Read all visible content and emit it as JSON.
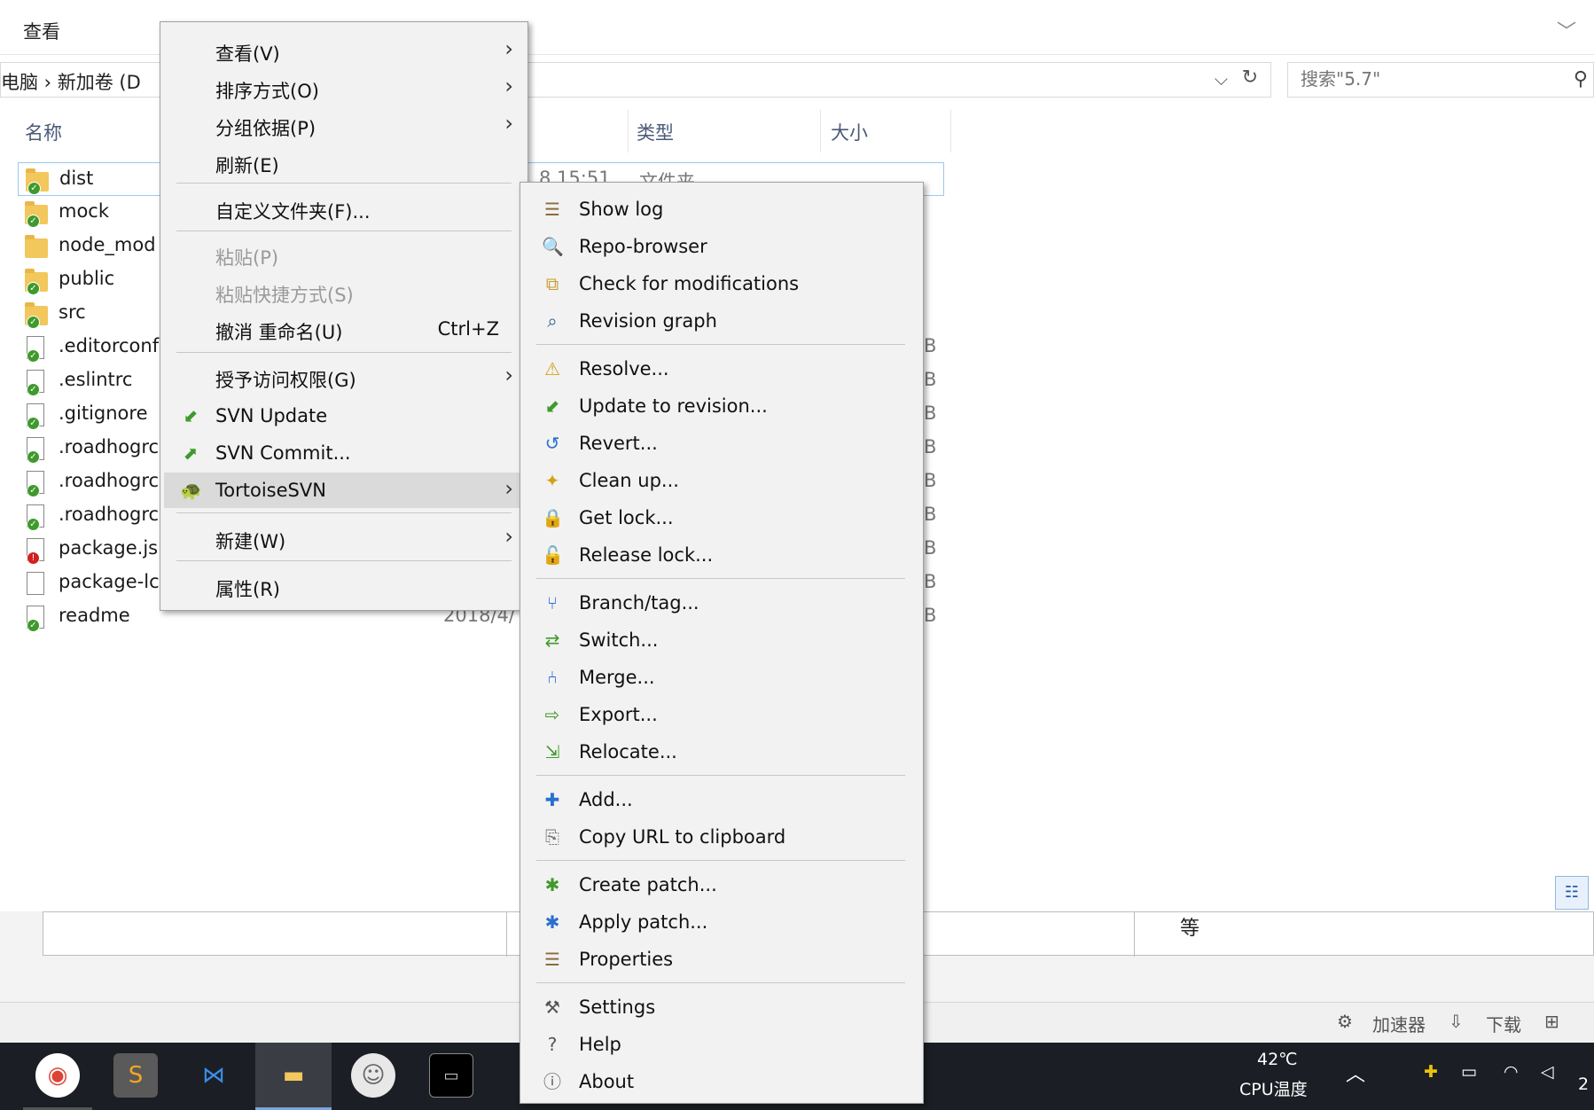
{
  "ribbon": {
    "tab_view": "查看",
    "expand_icon": "chevron-down-icon"
  },
  "address": {
    "path": "电脑  ›  新加卷 (D"
  },
  "search": {
    "placeholder": "搜索\"5.7\""
  },
  "columns": {
    "name": "名称",
    "type": "类型",
    "size": "大小"
  },
  "files": [
    {
      "name": "dist",
      "kind": "folder",
      "date": "8 15:51",
      "type": "文件夹",
      "size": ""
    },
    {
      "name": "mock",
      "kind": "folder",
      "date": "",
      "type": "",
      "size": ""
    },
    {
      "name": "node_mod",
      "kind": "folder-plain",
      "date": "",
      "type": "",
      "size": ""
    },
    {
      "name": "public",
      "kind": "folder",
      "date": "",
      "type": "",
      "size": ""
    },
    {
      "name": "src",
      "kind": "folder",
      "date": "",
      "type": "",
      "size": ""
    },
    {
      "name": ".editorconf",
      "kind": "doc",
      "date": "",
      "type": "",
      "size": "B"
    },
    {
      "name": ".eslintrc",
      "kind": "doc",
      "date": "",
      "type": "",
      "size": "B"
    },
    {
      "name": ".gitignore",
      "kind": "doc",
      "date": "",
      "type": "",
      "size": "B"
    },
    {
      "name": ".roadhogrc",
      "kind": "doc",
      "date": "",
      "type": "",
      "size": "B"
    },
    {
      "name": ".roadhogrc",
      "kind": "doc",
      "date": "",
      "type": "",
      "size": "B"
    },
    {
      "name": ".roadhogrc",
      "kind": "doc-modified",
      "date": "",
      "type": "",
      "size": "B"
    },
    {
      "name": "package.js",
      "kind": "doc-error",
      "date": "",
      "type": "",
      "size": "B"
    },
    {
      "name": "package-lc",
      "kind": "doc-plain",
      "date": "",
      "type": "",
      "size": "B"
    },
    {
      "name": "readme",
      "kind": "doc",
      "date": "2018/4/",
      "type": "",
      "size": "B"
    }
  ],
  "context_menu": {
    "items": [
      {
        "label": "查看(V)",
        "submenu": true
      },
      {
        "label": "排序方式(O)",
        "submenu": true
      },
      {
        "label": "分组依据(P)",
        "submenu": true
      },
      {
        "label": "刷新(E)"
      },
      {
        "label": "自定义文件夹(F)..."
      },
      {
        "label": "粘贴(P)",
        "disabled": true
      },
      {
        "label": "粘贴快捷方式(S)",
        "disabled": true
      },
      {
        "label": "撤消 重命名(U)",
        "shortcut": "Ctrl+Z"
      },
      {
        "label": "授予访问权限(G)",
        "submenu": true
      },
      {
        "label": "SVN Update",
        "icon": "svn-update-icon"
      },
      {
        "label": "SVN Commit...",
        "icon": "svn-commit-icon"
      },
      {
        "label": "TortoiseSVN",
        "icon": "tortoise-icon",
        "submenu": true
      },
      {
        "label": "新建(W)",
        "submenu": true
      },
      {
        "label": "属性(R)"
      }
    ]
  },
  "svn_menu": {
    "items": [
      {
        "label": "Show log",
        "icon": "show-log-icon"
      },
      {
        "label": "Repo-browser",
        "icon": "repo-browser-icon"
      },
      {
        "label": "Check for modifications",
        "icon": "check-modifications-icon"
      },
      {
        "label": "Revision graph",
        "icon": "revision-graph-icon"
      },
      {
        "label": "Resolve...",
        "icon": "resolve-icon"
      },
      {
        "label": "Update to revision...",
        "icon": "update-revision-icon"
      },
      {
        "label": "Revert...",
        "icon": "revert-icon"
      },
      {
        "label": "Clean up...",
        "icon": "cleanup-icon"
      },
      {
        "label": "Get lock...",
        "icon": "lock-icon"
      },
      {
        "label": "Release lock...",
        "icon": "unlock-icon"
      },
      {
        "label": "Branch/tag...",
        "icon": "branch-icon"
      },
      {
        "label": "Switch...",
        "icon": "switch-icon"
      },
      {
        "label": "Merge...",
        "icon": "merge-icon"
      },
      {
        "label": "Export...",
        "icon": "export-icon"
      },
      {
        "label": "Relocate...",
        "icon": "relocate-icon"
      },
      {
        "label": "Add...",
        "icon": "add-icon"
      },
      {
        "label": "Copy URL to clipboard",
        "icon": "copy-url-icon"
      },
      {
        "label": "Create patch...",
        "icon": "create-patch-icon"
      },
      {
        "label": "Apply patch...",
        "icon": "apply-patch-icon"
      },
      {
        "label": "Properties",
        "icon": "properties-icon"
      },
      {
        "label": "Settings",
        "icon": "settings-icon"
      },
      {
        "label": "Help",
        "icon": "help-icon"
      },
      {
        "label": "About",
        "icon": "about-icon"
      }
    ]
  },
  "background_doc": {
    "cell_text": "等"
  },
  "statusbar": {
    "accelerator": "加速器",
    "download": "下载"
  },
  "taskbar": {
    "temp": "42℃",
    "temp_label": "CPU温度",
    "clock_partial": "2"
  },
  "colors": {
    "accent": "#3f9a2c",
    "menu_bg": "#f2f2f2",
    "taskbar": "#1b1e24"
  }
}
